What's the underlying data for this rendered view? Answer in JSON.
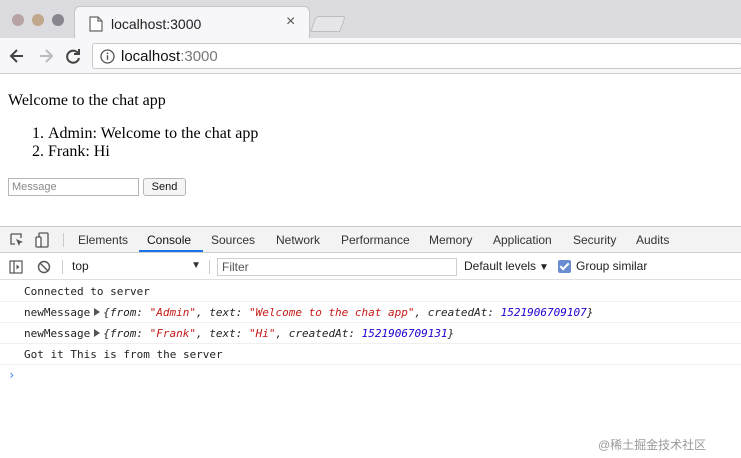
{
  "browser": {
    "tab_title": "localhost:3000",
    "url_host": "localhost",
    "url_port": ":3000"
  },
  "page": {
    "welcome": "Welcome to the chat app",
    "messages": [
      {
        "text": "Admin: Welcome to the chat app"
      },
      {
        "text": "Frank: Hi"
      }
    ],
    "message_placeholder": "Message",
    "send_label": "Send"
  },
  "devtools": {
    "tabs": [
      "Elements",
      "Console",
      "Sources",
      "Network",
      "Performance",
      "Memory",
      "Application",
      "Security",
      "Audits"
    ],
    "active_tab": "Console",
    "context": "top",
    "filter_placeholder": "Filter",
    "levels_label": "Default levels",
    "group_similar_label": "Group similar",
    "group_similar_checked": true,
    "logs": [
      {
        "plain": "Connected to server"
      },
      {
        "prefix": "newMessage",
        "from": "\"Admin\"",
        "text": "\"Welcome to the chat app\"",
        "createdAt": "1521906709107"
      },
      {
        "prefix": "newMessage",
        "from": "\"Frank\"",
        "text": "\"Hi\"",
        "createdAt": "1521906709131"
      },
      {
        "plain": "Got it This is from the server"
      }
    ],
    "prompt_symbol": "›"
  },
  "watermark": "@稀土掘金技术社区"
}
